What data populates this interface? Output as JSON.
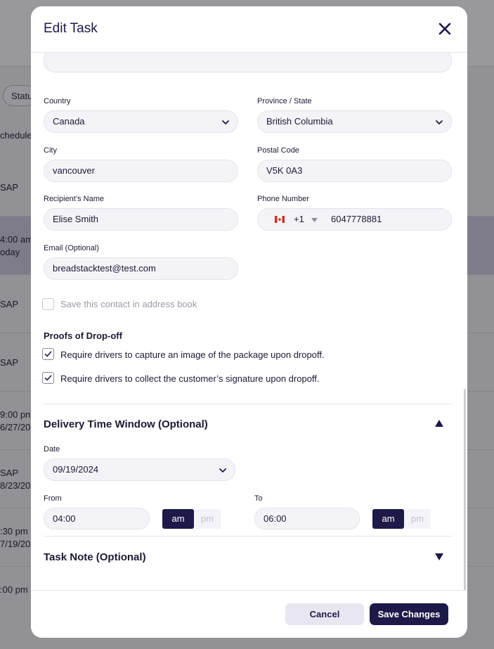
{
  "background": {
    "status_pill": "Statu",
    "column_header": "chedule",
    "rows": [
      {
        "line1": "SAP",
        "line2": ""
      },
      {
        "line1": "4:00 am",
        "line2": "oday"
      },
      {
        "line1": "SAP",
        "line2": ""
      },
      {
        "line1": "SAP",
        "line2": ""
      },
      {
        "line1": "9:00 pn",
        "line2": "6/27/20"
      },
      {
        "line1": "SAP",
        "line2": "8/23/20"
      },
      {
        "line1": ":30 pm",
        "line2": "7/19/202"
      },
      {
        "line1": ":00 pm",
        "line2": ""
      }
    ]
  },
  "modal": {
    "title": "Edit Task",
    "address": {
      "country_label": "Country",
      "country_value": "Canada",
      "province_label": "Province / State",
      "province_value": "British Columbia",
      "city_label": "City",
      "city_value": "vancouver",
      "postal_label": "Postal Code",
      "postal_value": "V5K 0A3",
      "recipient_label": "Recipient’s Name",
      "recipient_value": "Elise Smith",
      "phone_label": "Phone Number",
      "phone_dial_code": "+1",
      "phone_value": "6047778881",
      "email_label": "Email (Optional)",
      "email_value": "breadstacktest@test.com",
      "save_contact_label": "Save this contact in address book",
      "save_contact_checked": false
    },
    "proofs": {
      "title": "Proofs of Drop-off",
      "image_label": "Require drivers to capture an image of the package upon dropoff.",
      "image_checked": true,
      "signature_label": "Require drivers to collect the customer’s signature upon dropoff.",
      "signature_checked": true
    },
    "delivery_window": {
      "title": "Delivery Time Window (Optional)",
      "expanded": true,
      "date_label": "Date",
      "date_value": "09/19/2024",
      "from_label": "From",
      "from_value": "04:00",
      "from_period": "am",
      "to_label": "To",
      "to_value": "06:00",
      "to_period": "am",
      "am_label": "am",
      "pm_label": "pm"
    },
    "task_note": {
      "title": "Task Note (Optional)",
      "expanded": false
    },
    "footer": {
      "cancel_label": "Cancel",
      "save_label": "Save Changes"
    }
  },
  "colors": {
    "primary": "#1d1a4a",
    "field_bg": "#f4f3f7",
    "flag_red": "#d52b1e",
    "overlay_bg": "#929196"
  }
}
